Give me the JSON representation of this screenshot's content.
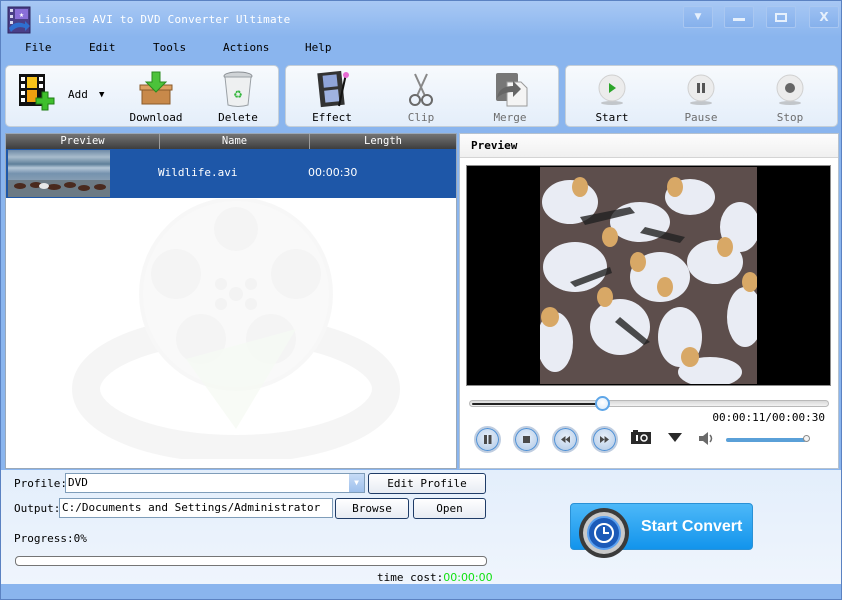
{
  "window": {
    "title": "Lionsea AVI to DVD Converter Ultimate",
    "controls": [
      {
        "name": "skin-menu-button",
        "icon": "caret-down-icon",
        "glyph": "▼"
      },
      {
        "name": "minimize-button",
        "icon": "minimize-icon",
        "glyph": "▬"
      },
      {
        "name": "maximize-button",
        "icon": "maximize-icon",
        "glyph": "□"
      },
      {
        "name": "close-button",
        "icon": "close-icon",
        "glyph": "X"
      }
    ]
  },
  "menu": [
    "File",
    "Edit",
    "Tools",
    "Actions",
    "Help"
  ],
  "toolbar": {
    "add": {
      "label": "Add",
      "icon": "film-add-icon"
    },
    "download": {
      "label": "Download",
      "icon": "download-box-icon"
    },
    "delete": {
      "label": "Delete",
      "icon": "recycle-bin-icon"
    },
    "effect": {
      "label": "Effect",
      "icon": "film-effect-icon"
    },
    "clip": {
      "label": "Clip",
      "icon": "scissors-icon"
    },
    "merge": {
      "label": "Merge",
      "icon": "merge-icon"
    },
    "start": {
      "label": "Start",
      "icon": "play-icon"
    },
    "pause": {
      "label": "Pause",
      "icon": "pause-icon"
    },
    "stop": {
      "label": "Stop",
      "icon": "stop-icon"
    }
  },
  "file_list": {
    "columns": [
      "Preview",
      "Name",
      "Length"
    ],
    "rows": [
      {
        "name": "Wildlife.avi",
        "length": "00:00:30",
        "selected": true
      }
    ]
  },
  "preview": {
    "title": "Preview",
    "time_current": "00:00:11",
    "time_total": "00:00:30",
    "time_readout": "00:00:11/00:00:30",
    "seek_fraction": 0.367,
    "volume_fraction": 1.0
  },
  "output": {
    "profile_label": "Profile:",
    "profile_value": "DVD",
    "edit_profile_label": "Edit Profile",
    "output_label": "Output:",
    "output_value": "C:/Documents and Settings/Administrator",
    "browse_label": "Browse",
    "open_label": "Open",
    "progress_label": "Progress:",
    "progress_value": "0%",
    "progress_fraction": 0,
    "time_cost_label": "time cost:",
    "time_cost_value": "00:00:00",
    "start_convert_label": "Start Convert"
  },
  "colors": {
    "window_blue": "#8ab5ee",
    "selection_blue": "#1e57a8",
    "time_cost_green": "#12e012",
    "start_convert_blue": "#1294ec"
  }
}
